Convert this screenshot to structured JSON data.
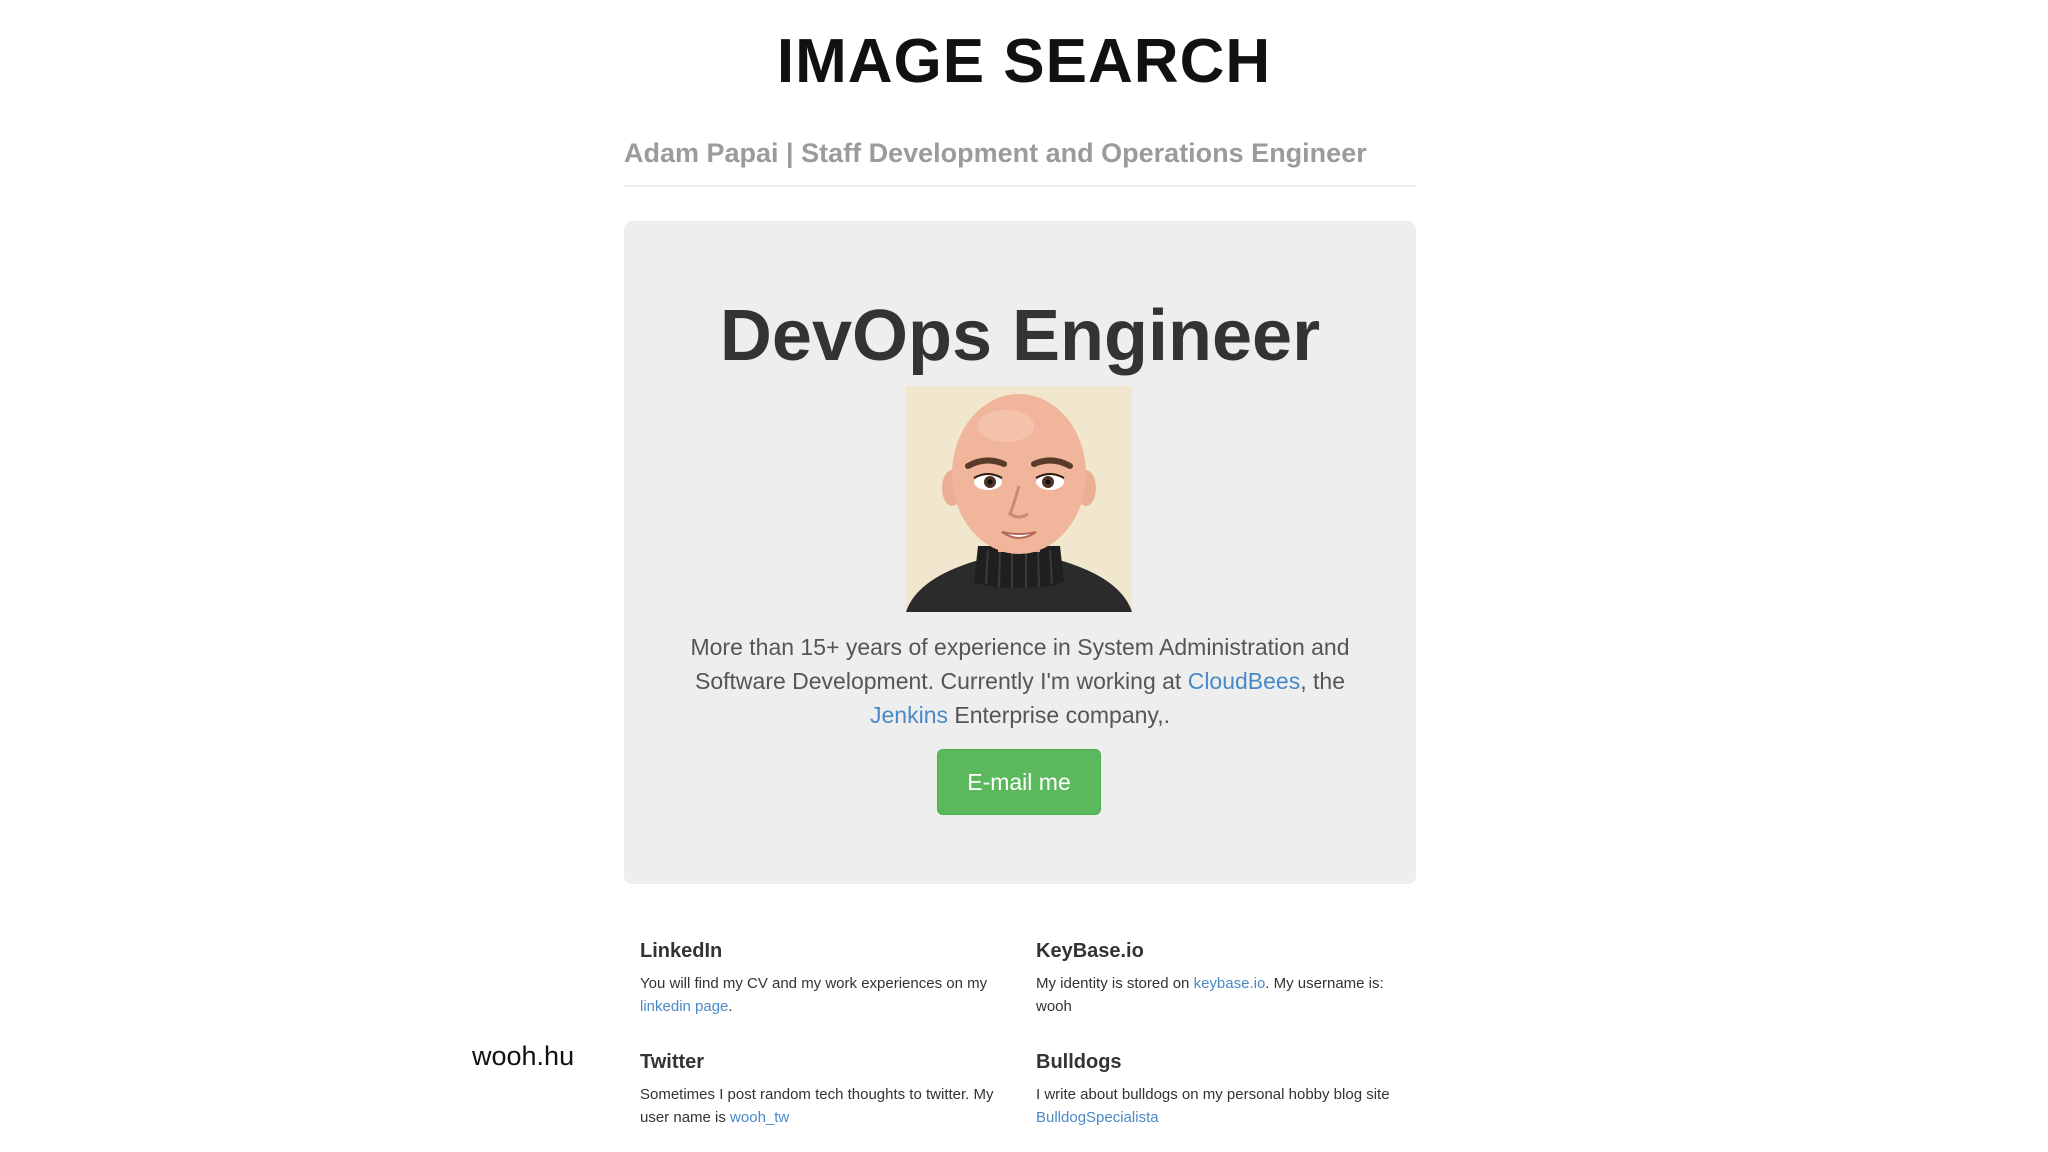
{
  "slide": {
    "title": "IMAGE SEARCH",
    "side_note": "wooh.hu"
  },
  "site": {
    "header_title": "Adam Papai | Staff Development and Operations Engineer",
    "jumbotron": {
      "title": "DevOps Engineer",
      "intro_part1": "More than 15+ years of experience in System Administration and Software Development. Currently I'm working at ",
      "link_cloudbees": "CloudBees",
      "intro_part2": ", the ",
      "link_jenkins": "Jenkins",
      "intro_part3": " Enterprise company,.",
      "email_button": "E-mail me"
    },
    "cards": {
      "linkedin": {
        "title": "LinkedIn",
        "text_before": "You will find my CV and my work experiences on my ",
        "link": "linkedin page",
        "text_after": "."
      },
      "keybase": {
        "title": "KeyBase.io",
        "text_before": "My identity is stored on ",
        "link": "keybase.io",
        "text_after": ". My username is: wooh"
      },
      "twitter": {
        "title": "Twitter",
        "text_before": "Sometimes I post random tech thoughts to twitter. My user name is ",
        "link": "wooh_tw",
        "text_after": ""
      },
      "bulldogs": {
        "title": "Bulldogs",
        "text_before": "I write about bulldogs on my personal hobby blog site ",
        "link": "BulldogSpecialista",
        "text_after": ""
      }
    }
  },
  "colors": {
    "link": "#4a89c8",
    "button": "#5cb85c",
    "jumbotron_bg": "#eeeeee",
    "header_text": "#9b9b9b"
  },
  "icons": {
    "avatar": "bald-man-cartoon-avatar"
  }
}
